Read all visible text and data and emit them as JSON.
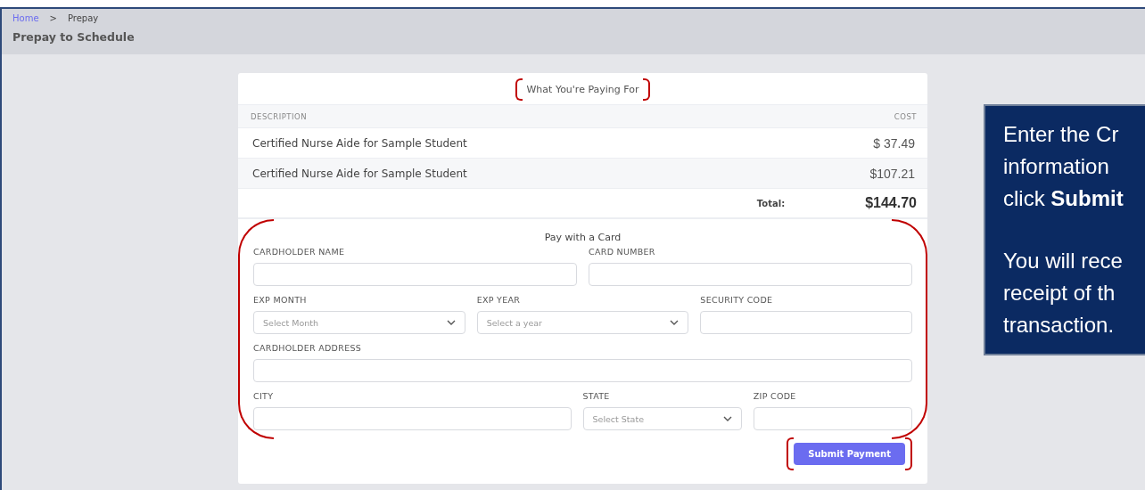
{
  "breadcrumb": [
    {
      "label": "Home",
      "link": true
    },
    {
      "label": "Prepay",
      "link": false
    }
  ],
  "breadcrumb_separator": ">",
  "page_title": "Prepay to Schedule",
  "summary": {
    "title": "What You're Paying For",
    "columns": [
      "DESCRIPTION",
      "COST"
    ],
    "rows": [
      {
        "description": "Certified Nurse Aide for Sample Student",
        "cost": "$ 37.49"
      },
      {
        "description": "Certified Nurse Aide for Sample Student",
        "cost": "$107.21"
      }
    ],
    "total_label": "Total:",
    "total": "$144.70"
  },
  "card_form": {
    "title": "Pay with a Card",
    "rows": [
      [
        {
          "label": "CARDHOLDER NAME",
          "kind": "text"
        },
        {
          "label": "CARD NUMBER",
          "kind": "text"
        }
      ],
      [
        {
          "label": "EXP MONTH",
          "kind": "select",
          "placeholder": "Select Month"
        },
        {
          "label": "EXP YEAR",
          "kind": "select",
          "placeholder": "Select a year"
        },
        {
          "label": "SECURITY CODE",
          "kind": "text"
        }
      ],
      [
        {
          "label": "CARDHOLDER ADDRESS",
          "kind": "text"
        }
      ],
      [
        {
          "label": "CITY",
          "kind": "text"
        },
        {
          "label": "STATE",
          "kind": "select",
          "placeholder": "Select State"
        },
        {
          "label": "ZIP CODE",
          "kind": "text"
        }
      ]
    ],
    "submit": "Submit Payment"
  },
  "callout": {
    "paragraphs": [
      [
        "Enter the Cr",
        "information",
        "click **Submit**"
      ],
      [
        "You will rece",
        "receipt of th",
        "transaction."
      ]
    ]
  }
}
